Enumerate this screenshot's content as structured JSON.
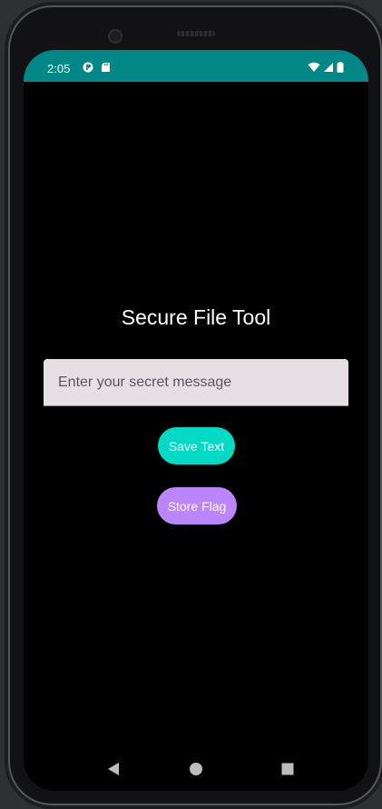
{
  "status_bar": {
    "time": "2:05",
    "background": "#018786",
    "left_icons": [
      "app-notification-icon",
      "sd-card-icon"
    ],
    "right_icons": [
      "wifi-icon",
      "cellular-signal-icon",
      "battery-icon"
    ]
  },
  "app": {
    "title": "Secure File Tool",
    "input": {
      "value": "",
      "placeholder": "Enter your secret message"
    },
    "buttons": {
      "save_text": "Save Text",
      "store_flag": "Store Flag"
    }
  },
  "colors": {
    "save_button": "#03dac5",
    "store_flag_button": "#bb86fc",
    "screen_background": "#000000",
    "input_background": "#e6e0e5"
  },
  "nav_bar": {
    "icons": [
      "back-icon",
      "home-icon",
      "recents-icon"
    ]
  }
}
